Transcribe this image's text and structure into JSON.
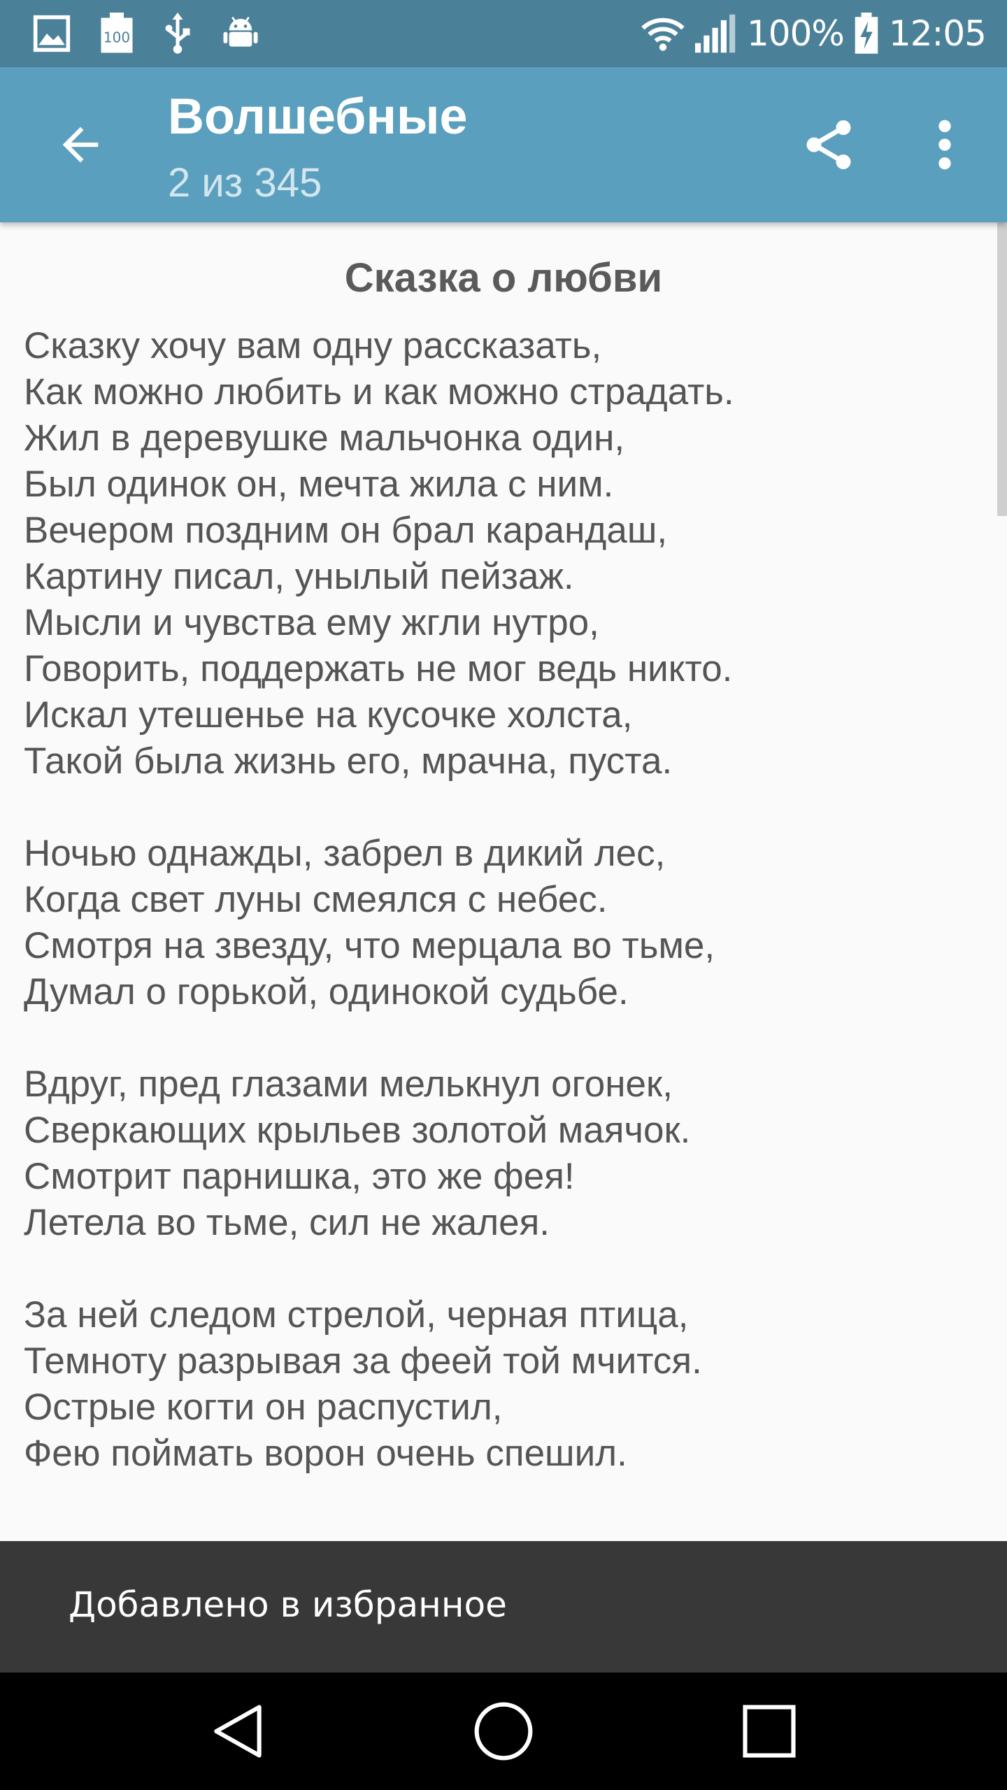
{
  "status_bar": {
    "battery_percent": "100%",
    "time": "12:05",
    "left_icons": [
      "image-icon",
      "battery-100-icon",
      "usb-icon",
      "android-icon"
    ],
    "right_icons": [
      "wifi-icon",
      "signal-icon",
      "battery-charging-icon"
    ]
  },
  "app_bar": {
    "title": "Волшебные",
    "subtitle": "2 из 345",
    "back_icon": "arrow-back-icon",
    "share_icon": "share-icon",
    "more_icon": "more-vert-icon",
    "color": "#5a9fbe"
  },
  "poem": {
    "title": "Сказка о любви",
    "lines": [
      "Сказку хочу вам одну рассказать,",
      "Как можно любить и как можно страдать.",
      "Жил в деревушке мальчонка один,",
      "Был одинок он, мечта жила с ним.",
      "Вечером поздним он брал карандаш,",
      "Картину писал, унылый пейзаж.",
      "Мысли и чувства ему жгли нутро,",
      "Говорить, поддержать не мог ведь никто.",
      "Искал утешенье на кусочке холста,",
      "Такой была жизнь его, мрачна, пуста.",
      "",
      "Ночью однажды, забрел в дикий лес,",
      "Когда свет луны смеялся с небес.",
      "Смотря на звезду, что мерцала во тьме,",
      "Думал о горькой, одинокой судьбе.",
      "",
      "Вдруг, пред глазами мелькнул огонек,",
      "Сверкающих крыльев золотой маячок.",
      "Смотрит парнишка, это же фея!",
      "Летела во тьме, сил не жалея.",
      "",
      "За ней следом стрелой, черная птица,",
      "Темноту разрывая за феей той мчится.",
      "Острые когти он распустил,",
      "Фею поймать ворон очень спешил."
    ]
  },
  "snackbar": {
    "message": "Добавлено в избранное"
  },
  "nav_bar": {
    "back_icon": "nav-back-icon",
    "home_icon": "nav-home-icon",
    "recents_icon": "nav-recents-icon"
  }
}
